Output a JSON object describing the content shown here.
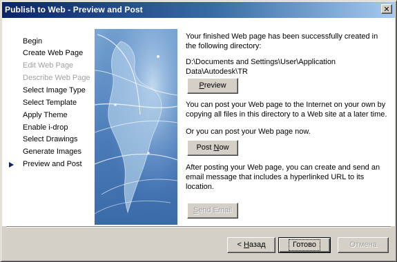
{
  "window": {
    "title": "Publish to Web - Preview and Post",
    "close_glyph": "✕"
  },
  "nav": {
    "items": [
      {
        "label": "Begin",
        "enabled": true
      },
      {
        "label": "Create Web Page",
        "enabled": true
      },
      {
        "label": "Edit Web Page",
        "enabled": false
      },
      {
        "label": "Describe Web Page",
        "enabled": false
      },
      {
        "label": "Select Image Type",
        "enabled": true
      },
      {
        "label": "Select Template",
        "enabled": true
      },
      {
        "label": "Apply Theme",
        "enabled": true
      },
      {
        "label": "Enable i-drop",
        "enabled": true
      },
      {
        "label": "Select Drawings",
        "enabled": true
      },
      {
        "label": "Generate Images",
        "enabled": true
      },
      {
        "label": "Preview and Post",
        "enabled": true,
        "current": true
      }
    ]
  },
  "main": {
    "success_text": "Your finished Web page has been successfully created in the following directory:",
    "directory": "D:\\Documents and Settings\\User\\Application Data\\Autodesk\\TR",
    "preview_button": {
      "accel": "P",
      "rest": "review"
    },
    "post_later_text": "You can post your Web page to the Internet on your own by copying all files in this directory to a Web site at a later time.",
    "post_now_prompt": "Or you can post your Web page now.",
    "post_now_button": {
      "pre": "Post ",
      "accel": "N",
      "rest": "ow"
    },
    "email_text": "After posting your Web page, you can create and send an email message that includes a hyperlinked URL to its location.",
    "send_email_button": {
      "accel": "S",
      "rest": "end Email"
    }
  },
  "footer": {
    "back_button": {
      "prefix": "< ",
      "accel": "Н",
      "rest": "азад"
    },
    "finish_label": "Готово",
    "cancel_label": "Отмена"
  },
  "colors": {
    "title_bar_start": "#0a246a",
    "title_bar_end": "#a6caf0",
    "dialog_face": "#d4d0c8",
    "disabled_text": "#a0a0a0",
    "banner_blue": "#4a7ab8"
  }
}
